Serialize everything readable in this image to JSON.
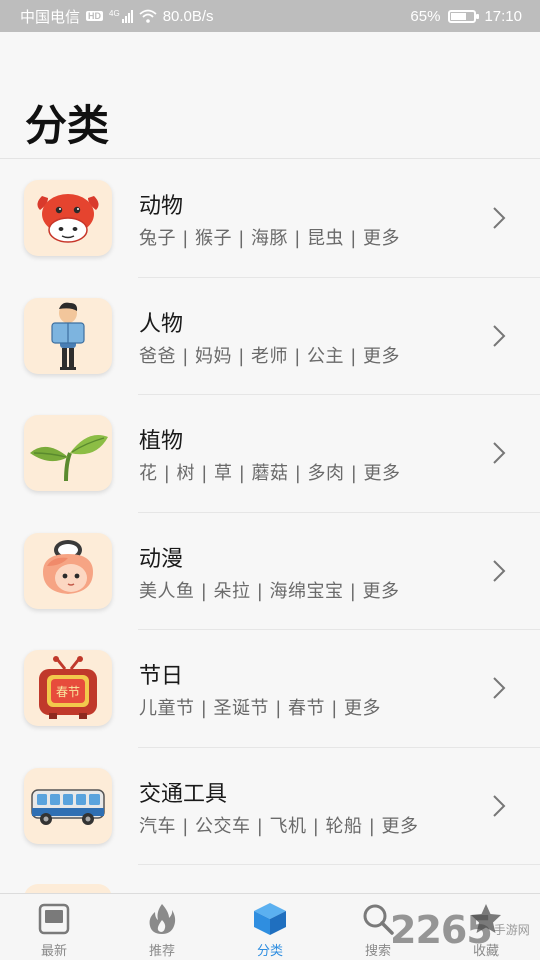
{
  "status_bar": {
    "carrier": "中国电信",
    "hd": "HD",
    "network": "4G",
    "speed": "80.0B/s",
    "battery": "65%",
    "battery_level": 0.65,
    "time": "17:10"
  },
  "page": {
    "title": "分类"
  },
  "categories": [
    {
      "title": "动物",
      "subtitle": "兔子 | 猴子 | 海豚 | 昆虫 | 更多",
      "icon": "cow-icon"
    },
    {
      "title": "人物",
      "subtitle": "爸爸 | 妈妈 | 老师 | 公主 | 更多",
      "icon": "reading-boy-icon"
    },
    {
      "title": "植物",
      "subtitle": "花 | 树 | 草 | 蘑菇 | 多肉 | 更多",
      "icon": "sprout-icon"
    },
    {
      "title": "动漫",
      "subtitle": "美人鱼 | 朵拉 | 海绵宝宝 | 更多",
      "icon": "anime-girl-icon"
    },
    {
      "title": "节日",
      "subtitle": "儿童节 | 圣诞节 | 春节 | 更多",
      "icon": "spring-festival-tv-icon",
      "icon_text": "春节"
    },
    {
      "title": "交通工具",
      "subtitle": "汽车 | 公交车 | 飞机 | 轮船 | 更多",
      "icon": "bus-icon"
    }
  ],
  "bottom_nav": {
    "items": [
      {
        "label": "最新",
        "icon": "latest-icon"
      },
      {
        "label": "推荐",
        "icon": "flame-icon"
      },
      {
        "label": "分类",
        "icon": "cube-icon",
        "active": true
      },
      {
        "label": "搜索",
        "icon": "search-icon"
      },
      {
        "label": "收藏",
        "icon": "star-icon"
      }
    ]
  },
  "watermark": {
    "number": "2265",
    "site": "手游网"
  },
  "colors": {
    "accent": "#2f8ee0",
    "thumb_bg": "#fdecd8",
    "status_bar": "#bdbdbd"
  }
}
